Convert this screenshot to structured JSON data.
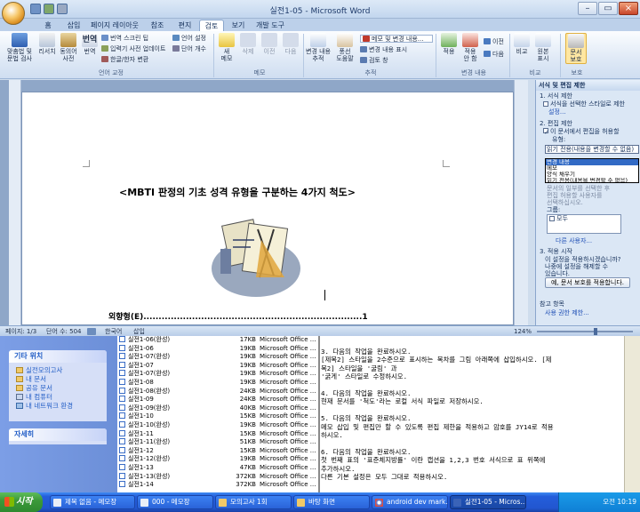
{
  "word": {
    "title": "실전1-05 - Microsoft Word",
    "tabs": [
      "홈",
      "삽입",
      "페이지 레이아웃",
      "참조",
      "편지",
      "검토",
      "보기",
      "개발 도구"
    ],
    "active_tab": "검토",
    "ribbon": {
      "spell": "맞춤법 및\n문법 검사",
      "research": "리서치",
      "thesaurus": "동의어\n사전",
      "translate": "번역",
      "translate_tip": "번역 스크린 팁",
      "ime_dict": "입력기 사전 업데이트",
      "hanja": "한글/한자 변환",
      "lang_set": "언어 설정",
      "word_count": "단어 개수",
      "group_lang": "언어 교정",
      "new_comment": "새\n메모",
      "delete": "삭제",
      "prev": "이전",
      "next": "다음",
      "group_comment": "메모",
      "track": "변경 내용\n추적",
      "balloon": "풍선\n도움말",
      "show_markup_dd": "메모 및 변경 내용...",
      "show_markup": "변경 내용 표시",
      "review_pane": "검토 창",
      "group_track": "추적",
      "accept": "적용",
      "reject": "적용\n안 함",
      "prev2": "이전",
      "next2": "다음",
      "group_changes": "변경 내용",
      "compare": "비교",
      "show_source": "원본\n표시",
      "group_compare": "비교",
      "protect": "문서\n보호",
      "group_protect": "보호"
    },
    "document": {
      "heading": "<MBTI 판정의 기초 성격 유형을 구분하는 4가지 척도>",
      "toc_line": "외향형(E)........................................................................1"
    },
    "status": {
      "page": "페이지: 1/3",
      "words": "단어 수: 504",
      "lang": "한국어",
      "mode": "삽입",
      "zoom": "124%"
    },
    "pane": {
      "title": "서식 및 편집 제한",
      "s1": "1. 서식 제한",
      "s1_check": "서식을 선택한 스타일로 제한",
      "s1_link": "설정...",
      "s2": "2. 편집 제한",
      "s2_check": "이 문서에서 편집을 허용할",
      "s2_type": "유형:",
      "select_value": "읽기 전용(내용을 변경할 수 없음)",
      "options": [
        "변경 내용",
        "메모",
        "양식 채우기",
        "읽기 전용(내용을 변경할 수 없음)"
      ],
      "except1": "문서의 일부를 선택한 후",
      "except2": "편집 허용할 사용자를",
      "except3": "선택하십시오.",
      "group": "그룹:",
      "group_item": "모두",
      "more_users": "다른 사용자...",
      "s3": "3. 적용 시작",
      "s3_text1": "이 설정을 적용하시겠습니까?",
      "s3_text2": "나중에 설정을 해제할 수",
      "s3_text3": "있습니다.",
      "apply_btn": "예, 문서 보호를 적용합니다.",
      "see_also": "참고 항목",
      "perm": "사용 권한 제한..."
    }
  },
  "explorer": {
    "box_other": "기타 위치",
    "other_items": [
      "실전모의고사",
      "내 문서",
      "공유 문서",
      "내 컴퓨터",
      "내 네트워크 환경"
    ],
    "box_detail": "자세히",
    "files": [
      {
        "name": "실전1-06(완성)",
        "size": "17KB",
        "type": "Microsoft Office ..."
      },
      {
        "name": "실전1-06",
        "size": "19KB",
        "type": "Microsoft Office ..."
      },
      {
        "name": "실전1-07(완성)",
        "size": "19KB",
        "type": "Microsoft Office ..."
      },
      {
        "name": "실전1-07",
        "size": "19KB",
        "type": "Microsoft Office ..."
      },
      {
        "name": "실전1-07(완성)",
        "size": "19KB",
        "type": "Microsoft Office ..."
      },
      {
        "name": "실전1-08",
        "size": "19KB",
        "type": "Microsoft Office ..."
      },
      {
        "name": "실전1-08(완성)",
        "size": "24KB",
        "type": "Microsoft Office ..."
      },
      {
        "name": "실전1-09",
        "size": "24KB",
        "type": "Microsoft Office ..."
      },
      {
        "name": "실전1-09(완성)",
        "size": "40KB",
        "type": "Microsoft Office ..."
      },
      {
        "name": "실전1-10",
        "size": "15KB",
        "type": "Microsoft Office ..."
      },
      {
        "name": "실전1-10(완성)",
        "size": "19KB",
        "type": "Microsoft Office ..."
      },
      {
        "name": "실전1-11",
        "size": "15KB",
        "type": "Microsoft Office ..."
      },
      {
        "name": "실전1-11(완성)",
        "size": "51KB",
        "type": "Microsoft Office ..."
      },
      {
        "name": "실전1-12",
        "size": "15KB",
        "type": "Microsoft Office ..."
      },
      {
        "name": "실전1-12(완성)",
        "size": "19KB",
        "type": "Microsoft Office ..."
      },
      {
        "name": "실전1-13",
        "size": "47KB",
        "type": "Microsoft Office ..."
      },
      {
        "name": "실전1-13(완성)",
        "size": "372KB",
        "type": "Microsoft Office ..."
      },
      {
        "name": "실전1-14",
        "size": "372KB",
        "type": "Microsoft Office ..."
      }
    ]
  },
  "notepad": {
    "lines": [
      "3. 다음의 작업을 완료하시오.",
      "   [제목2] 스타일을 2수준으로 표시하는 목차를 그림 아래쪽에 삽입하시오. [제",
      "목2] 스타일을 '굴림' 과",
      "   '굵게' 스타일로 수정하시오.",
      "",
      "4. 다음의 작업을 완료하시오.",
      "   현재 문서를 '척도'라는 로컬 서식 파일로 저장하시오.",
      "",
      "5. 다음의 작업을 완료하시오.",
      "   메모 삽입 및 편집만 할 수 있도록 편집 제한을 적용하고 암호를 JY14로 적용",
      "하시오.",
      "",
      "6. 다음의 작업을 완료하시오.",
      "   첫 번째 표의 '표준체지방률' 이란 캡션을 1,2,3 번호 서식으로 표 위쪽에",
      "추가하시오.",
      "   다른 기본 설정은 모두 그대로 적용하시오."
    ]
  },
  "taskbar": {
    "start": "시작",
    "items": [
      "제목 없음 - 메모장",
      "000 - 메모장",
      "모의고사 1회",
      "바탕 화면",
      "android dev mark...",
      "실전1-05 - Micros..."
    ],
    "clock": "오전 10:19"
  }
}
